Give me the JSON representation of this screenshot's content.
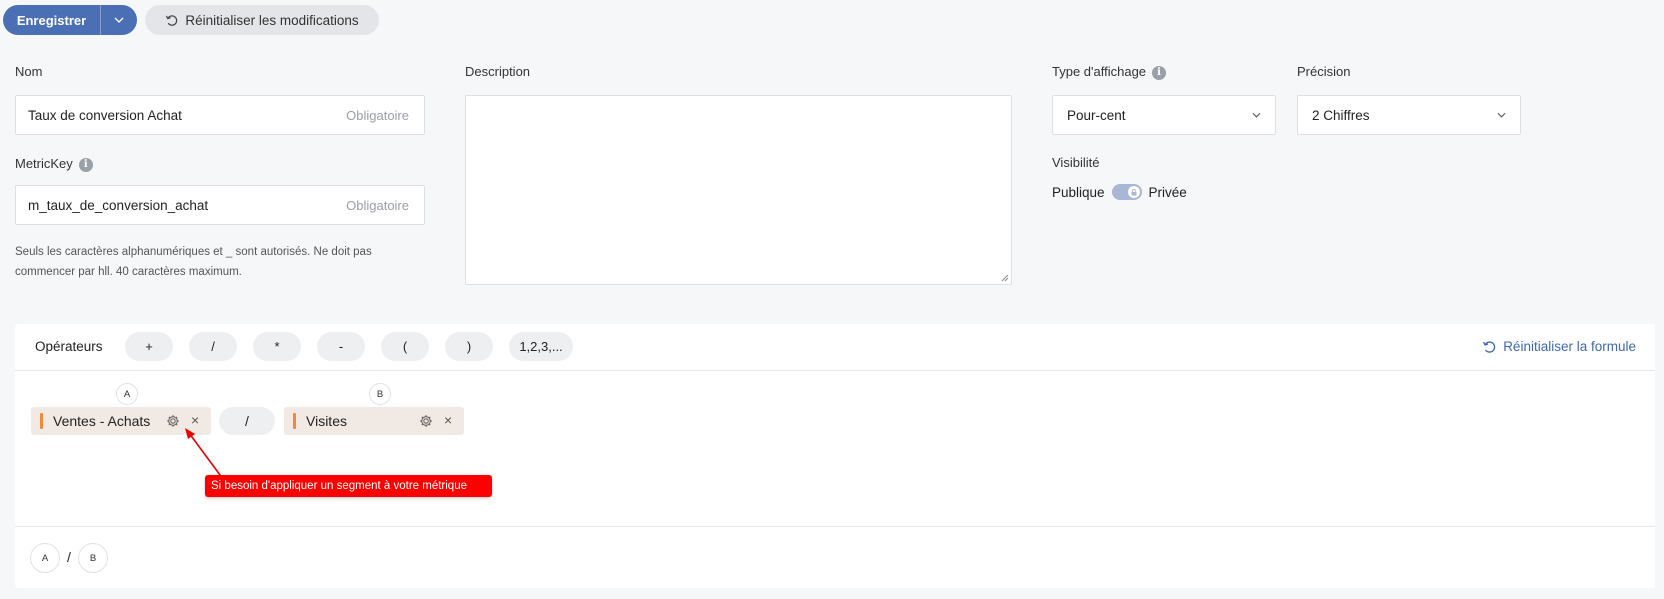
{
  "toolbar": {
    "save_label": "Enregistrer",
    "reset_label": "Réinitialiser les modifications"
  },
  "form": {
    "name": {
      "label": "Nom",
      "value": "Taux de conversion Achat",
      "hint": "Obligatoire"
    },
    "metrickey": {
      "label": "MetricKey",
      "value": "m_taux_de_conversion_achat",
      "hint": "Obligatoire",
      "help_line1": "Seuls les caractères alphanumériques et _ sont autorisés. Ne doit pas",
      "help_line2": "commencer par hll. 40 caractères maximum."
    },
    "description": {
      "label": "Description",
      "value": ""
    },
    "display_type": {
      "label": "Type d'affichage",
      "selected": "Pour-cent"
    },
    "precision": {
      "label": "Précision",
      "selected": "2 Chiffres"
    },
    "visibility": {
      "label": "Visibilité",
      "left": "Publique",
      "right": "Privée"
    }
  },
  "formula": {
    "operators_label": "Opérateurs",
    "operators": [
      "+",
      "/",
      "*",
      "-",
      "(",
      ")",
      "1,2,3,..."
    ],
    "reset_label": "Réinitialiser la formule",
    "metric_a": {
      "badge": "A",
      "name": "Ventes - Achats"
    },
    "operator": "/",
    "metric_b": {
      "badge": "B",
      "name": "Visites"
    },
    "tooltip": "Si besoin d'appliquer un segment à votre métrique",
    "summary": {
      "a": "A",
      "op": "/",
      "b": "B"
    }
  },
  "colors": {
    "primary": "#4a6fb5",
    "accent_bar": "#f08a3a",
    "tooltip": "#ff0000",
    "link": "#3f68b0"
  }
}
